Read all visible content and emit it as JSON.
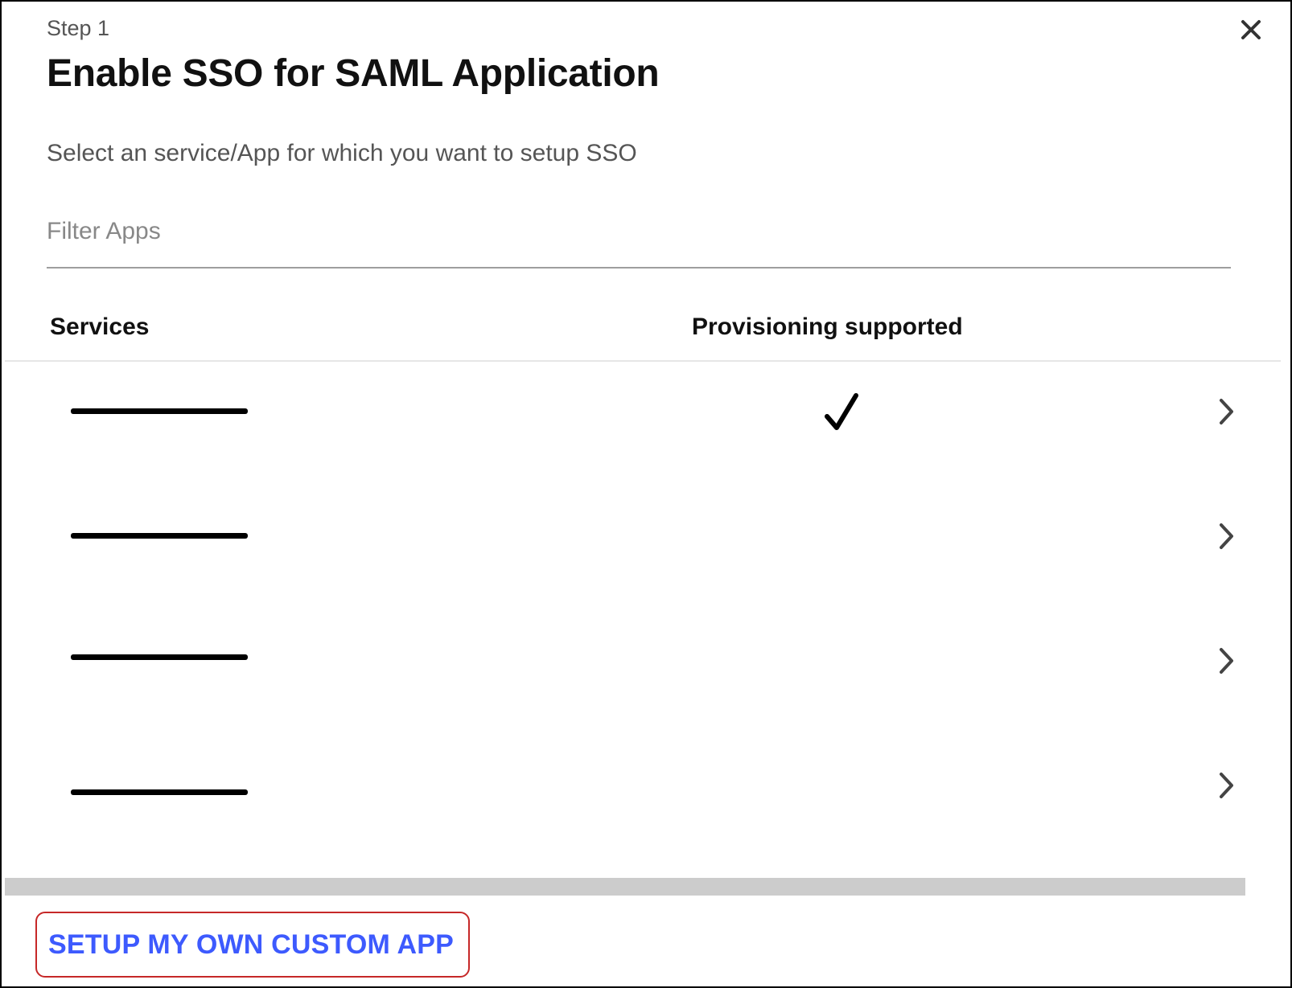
{
  "dialog": {
    "step_label": "Step 1",
    "title": "Enable SSO for SAML Application",
    "subtitle": "Select an service/App for which you want to setup SSO",
    "close_icon": "close-icon"
  },
  "filter": {
    "placeholder": "Filter Apps",
    "value": ""
  },
  "table": {
    "columns": [
      "Services",
      "Provisioning supported"
    ],
    "rows": [
      {
        "provisioning_supported": true,
        "service_name_redacted": true
      },
      {
        "provisioning_supported": false,
        "service_name_redacted": true
      },
      {
        "provisioning_supported": false,
        "service_name_redacted": true
      },
      {
        "provisioning_supported": false,
        "service_name_redacted": true
      }
    ],
    "row_icons": {
      "check": "checkmark-icon",
      "open": "chevron-right-icon"
    }
  },
  "footer": {
    "custom_app_button": "SETUP MY OWN CUSTOM APP"
  },
  "colors": {
    "link_blue": "#3d5afe",
    "highlight_red": "#c62828",
    "scrollbar_gray": "#cccccc",
    "text_dark": "#111111",
    "text_muted": "#555555"
  }
}
